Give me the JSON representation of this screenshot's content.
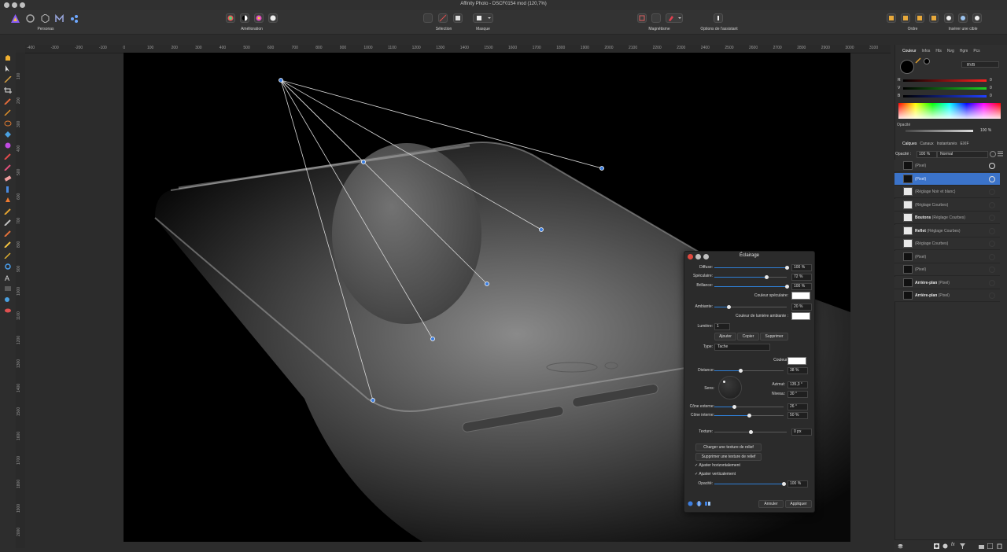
{
  "window": {
    "title": "Affinity Photo - DSCF0154 mod (120,7%)"
  },
  "toolbar": {
    "personas_label": "Personas",
    "amelioration_label": "Amélioration",
    "selection_label": "Sélection",
    "masque_label": "Masque",
    "magnetisme_label": "Magnétisme",
    "assistant_label": "Options de l'assistant",
    "ordre_label": "Ordre",
    "inserer_label": "Insérer une cible"
  },
  "ruler": {
    "top": [
      "-400",
      "-300",
      "-200",
      "-100",
      "0",
      "100",
      "200",
      "300",
      "400",
      "500",
      "600",
      "700",
      "800",
      "900",
      "1000",
      "1100",
      "1200",
      "1300",
      "1400",
      "1500",
      "1600",
      "1700",
      "1800",
      "1900",
      "2000",
      "2100",
      "2200",
      "2300",
      "2400",
      "2500",
      "2600",
      "2700",
      "2800",
      "2900",
      "3000",
      "3100"
    ],
    "left": [
      "100",
      "200",
      "300",
      "400",
      "500",
      "600",
      "700",
      "800",
      "900",
      "1000",
      "1100",
      "1200",
      "1300",
      "1400",
      "1500",
      "1600",
      "1700",
      "1800",
      "1900",
      "2000"
    ]
  },
  "color_panel": {
    "tabs": [
      "Couleur",
      "Infos",
      "Hts",
      "Nvg",
      "Hgm",
      "Pcs"
    ],
    "mode": "RVB",
    "channels": [
      {
        "name": "R",
        "value": "0"
      },
      {
        "name": "V",
        "value": "0"
      },
      {
        "name": "B",
        "value": "0"
      }
    ],
    "opacity_label": "Opacité",
    "opacity_value": "100 %"
  },
  "layers_panel": {
    "tabs": [
      "Calques",
      "Canaux",
      "Instantanés",
      "EXIF"
    ],
    "opacity_label": "Opacité :",
    "opacity_value": "100 %",
    "blend_mode": "Normal",
    "layers": [
      {
        "name": "",
        "type": "(Pixel)",
        "selected": false
      },
      {
        "name": "",
        "type": "(Pixel)",
        "selected": true
      },
      {
        "name": "",
        "type": "(Réglage Noir et blanc)",
        "selected": false
      },
      {
        "name": "",
        "type": "(Réglage Courbes)",
        "selected": false
      },
      {
        "name": "Boutons",
        "type": "(Réglage Courbes)",
        "selected": false
      },
      {
        "name": "Reflet",
        "type": "(Réglage Courbes)",
        "selected": false
      },
      {
        "name": "",
        "type": "(Réglage Courbes)",
        "selected": false
      },
      {
        "name": "",
        "type": "(Pixel)",
        "selected": false
      },
      {
        "name": "",
        "type": "(Pixel)",
        "selected": false
      },
      {
        "name": "Arrière-plan",
        "type": "(Pixel)",
        "selected": false
      },
      {
        "name": "Arrière-plan",
        "type": "(Pixel)",
        "selected": false
      }
    ]
  },
  "dialog": {
    "title": "Éclairage",
    "diffuse_label": "Diffuse:",
    "diffuse_value": "100 %",
    "diffuse_level": 1.0,
    "speculaire_label": "Spéculaire:",
    "speculaire_value": "72 %",
    "speculaire_level": 0.72,
    "brillance_label": "Brillance:",
    "brillance_value": "100 %",
    "brillance_level": 1.0,
    "couleur_speculaire_label": "Couleur spéculaire:",
    "ambiante_label": "Ambiante:",
    "ambiante_value": "20 %",
    "ambiante_level": 0.2,
    "couleur_ambiante_label": "Couleur de lumière ambiante :",
    "lumiere_label": "Lumière:",
    "lumiere_value": "1",
    "ajouter": "Ajouter",
    "copier": "Copier",
    "supprimer": "Supprimer",
    "type_label": "Type:",
    "type_value": "Tache",
    "couleur_label": "Couleur:",
    "distance_label": "Distance:",
    "distance_value": "38 %",
    "distance_level": 0.38,
    "sens_label": "Sens:",
    "azimut_label": "Azimut:",
    "azimut_value": "135,3 °",
    "niveau_label": "Niveau:",
    "niveau_value": "30 °",
    "cone_externe_label": "Cône externe:",
    "cone_externe_value": "26 °",
    "cone_externe_level": 0.29,
    "cone_interne_label": "Cône interne:",
    "cone_interne_value": "50 %",
    "cone_interne_level": 0.5,
    "texture_label": "Texture:",
    "texture_value": "0 px",
    "texture_level": 0.5,
    "charger_texture": "Charger une texture de relief",
    "supprimer_texture": "Supprimer une texture de relief",
    "ajuster_h": "Ajuster horizontalement",
    "ajuster_v": "Ajuster verticalement",
    "opacite_label": "Opacité:",
    "opacite_value": "100 %",
    "opacite_level": 1.0,
    "annuler": "Annuler",
    "appliquer": "Appliquer"
  }
}
